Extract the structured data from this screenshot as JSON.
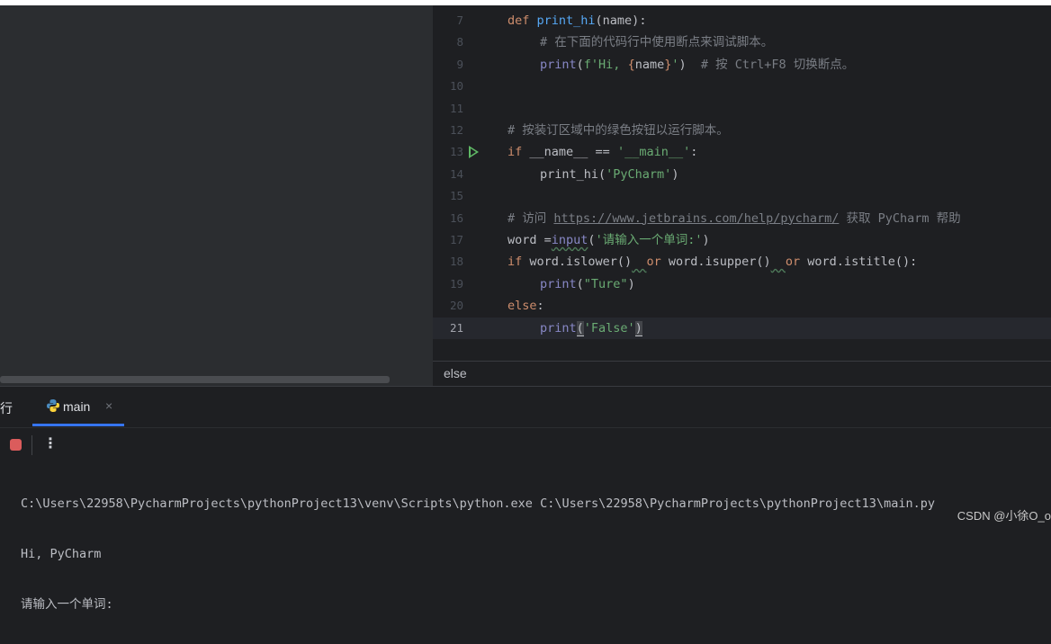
{
  "editor": {
    "lines": [
      {
        "num": "7",
        "tokens": [
          {
            "t": "def ",
            "c": "kw"
          },
          {
            "t": "print_hi",
            "c": "fn"
          },
          {
            "t": "(name):",
            "c": ""
          }
        ]
      },
      {
        "num": "8",
        "indent": 1,
        "tokens": [
          {
            "t": "# 在下面的代码行中使用断点来调试脚本。",
            "c": "cmt"
          }
        ]
      },
      {
        "num": "9",
        "indent": 1,
        "tokens": [
          {
            "t": "print",
            "c": "bi"
          },
          {
            "t": "(",
            "c": ""
          },
          {
            "t": "f'Hi, ",
            "c": "str"
          },
          {
            "t": "{",
            "c": "fstr-brace"
          },
          {
            "t": "name",
            "c": "fstr-var"
          },
          {
            "t": "}",
            "c": "fstr-brace"
          },
          {
            "t": "'",
            "c": "str"
          },
          {
            "t": ")  ",
            "c": ""
          },
          {
            "t": "# 按 Ctrl+F8 切换断点。",
            "c": "cmt"
          }
        ]
      },
      {
        "num": "10",
        "tokens": []
      },
      {
        "num": "11",
        "tokens": []
      },
      {
        "num": "12",
        "tokens": [
          {
            "t": "# 按装订区域中的绿色按钮以运行脚本。",
            "c": "cmt"
          }
        ]
      },
      {
        "num": "13",
        "run": true,
        "tokens": [
          {
            "t": "if ",
            "c": "kw"
          },
          {
            "t": "__name__ == ",
            "c": ""
          },
          {
            "t": "'__main__'",
            "c": "str"
          },
          {
            "t": ":",
            "c": ""
          }
        ]
      },
      {
        "num": "14",
        "indent": 1,
        "tokens": [
          {
            "t": "print_hi(",
            "c": ""
          },
          {
            "t": "'PyCharm'",
            "c": "str"
          },
          {
            "t": ")",
            "c": ""
          }
        ]
      },
      {
        "num": "15",
        "tokens": []
      },
      {
        "num": "16",
        "tokens": [
          {
            "t": "# 访问 ",
            "c": "cmt"
          },
          {
            "t": "https://www.jetbrains.com/help/pycharm/",
            "c": "url"
          },
          {
            "t": " 获取 PyCharm 帮助",
            "c": "cmt"
          }
        ]
      },
      {
        "num": "17",
        "tokens": [
          {
            "t": "word =",
            "c": ""
          },
          {
            "t": "input",
            "c": "bi sq"
          },
          {
            "t": "(",
            "c": ""
          },
          {
            "t": "'请输入一个单词:'",
            "c": "str"
          },
          {
            "t": ")",
            "c": ""
          }
        ]
      },
      {
        "num": "18",
        "tokens": [
          {
            "t": "if ",
            "c": "kw"
          },
          {
            "t": "word.islower()",
            "c": ""
          },
          {
            "t": "  ",
            "c": "sq"
          },
          {
            "t": "or ",
            "c": "kw"
          },
          {
            "t": "word.isupper()",
            "c": ""
          },
          {
            "t": "  ",
            "c": "sq"
          },
          {
            "t": "or ",
            "c": "kw"
          },
          {
            "t": "word.istitle():",
            "c": ""
          }
        ]
      },
      {
        "num": "19",
        "indent": 1,
        "tokens": [
          {
            "t": "print",
            "c": "bi"
          },
          {
            "t": "(",
            "c": ""
          },
          {
            "t": "\"Ture\"",
            "c": "str"
          },
          {
            "t": ")",
            "c": ""
          }
        ]
      },
      {
        "num": "20",
        "tokens": [
          {
            "t": "else",
            "c": "kw"
          },
          {
            "t": ":",
            "c": ""
          }
        ]
      },
      {
        "num": "21",
        "indent": 1,
        "active": true,
        "tokens": [
          {
            "t": "print",
            "c": "bi"
          },
          {
            "t": "(",
            "c": "brace-match"
          },
          {
            "t": "'False'",
            "c": "str"
          },
          {
            "t": ")",
            "c": "brace-match"
          }
        ]
      }
    ]
  },
  "breadcrumb": {
    "text": "else"
  },
  "run_panel": {
    "title": "行",
    "tab": {
      "label": "main",
      "close": "×",
      "icon": "python-icon"
    },
    "toolbar": {
      "more": "⋮"
    },
    "console": [
      "C:\\Users\\22958\\PycharmProjects\\pythonProject13\\venv\\Scripts\\python.exe C:\\Users\\22958\\PycharmProjects\\pythonProject13\\main.py",
      "Hi, PyCharm",
      "请输入一个单词:"
    ]
  },
  "watermark": "CSDN @小徐O_o",
  "colors": {
    "accent": "#3574f0",
    "run_green": "#5fb865",
    "stop_red": "#db5c5c"
  }
}
